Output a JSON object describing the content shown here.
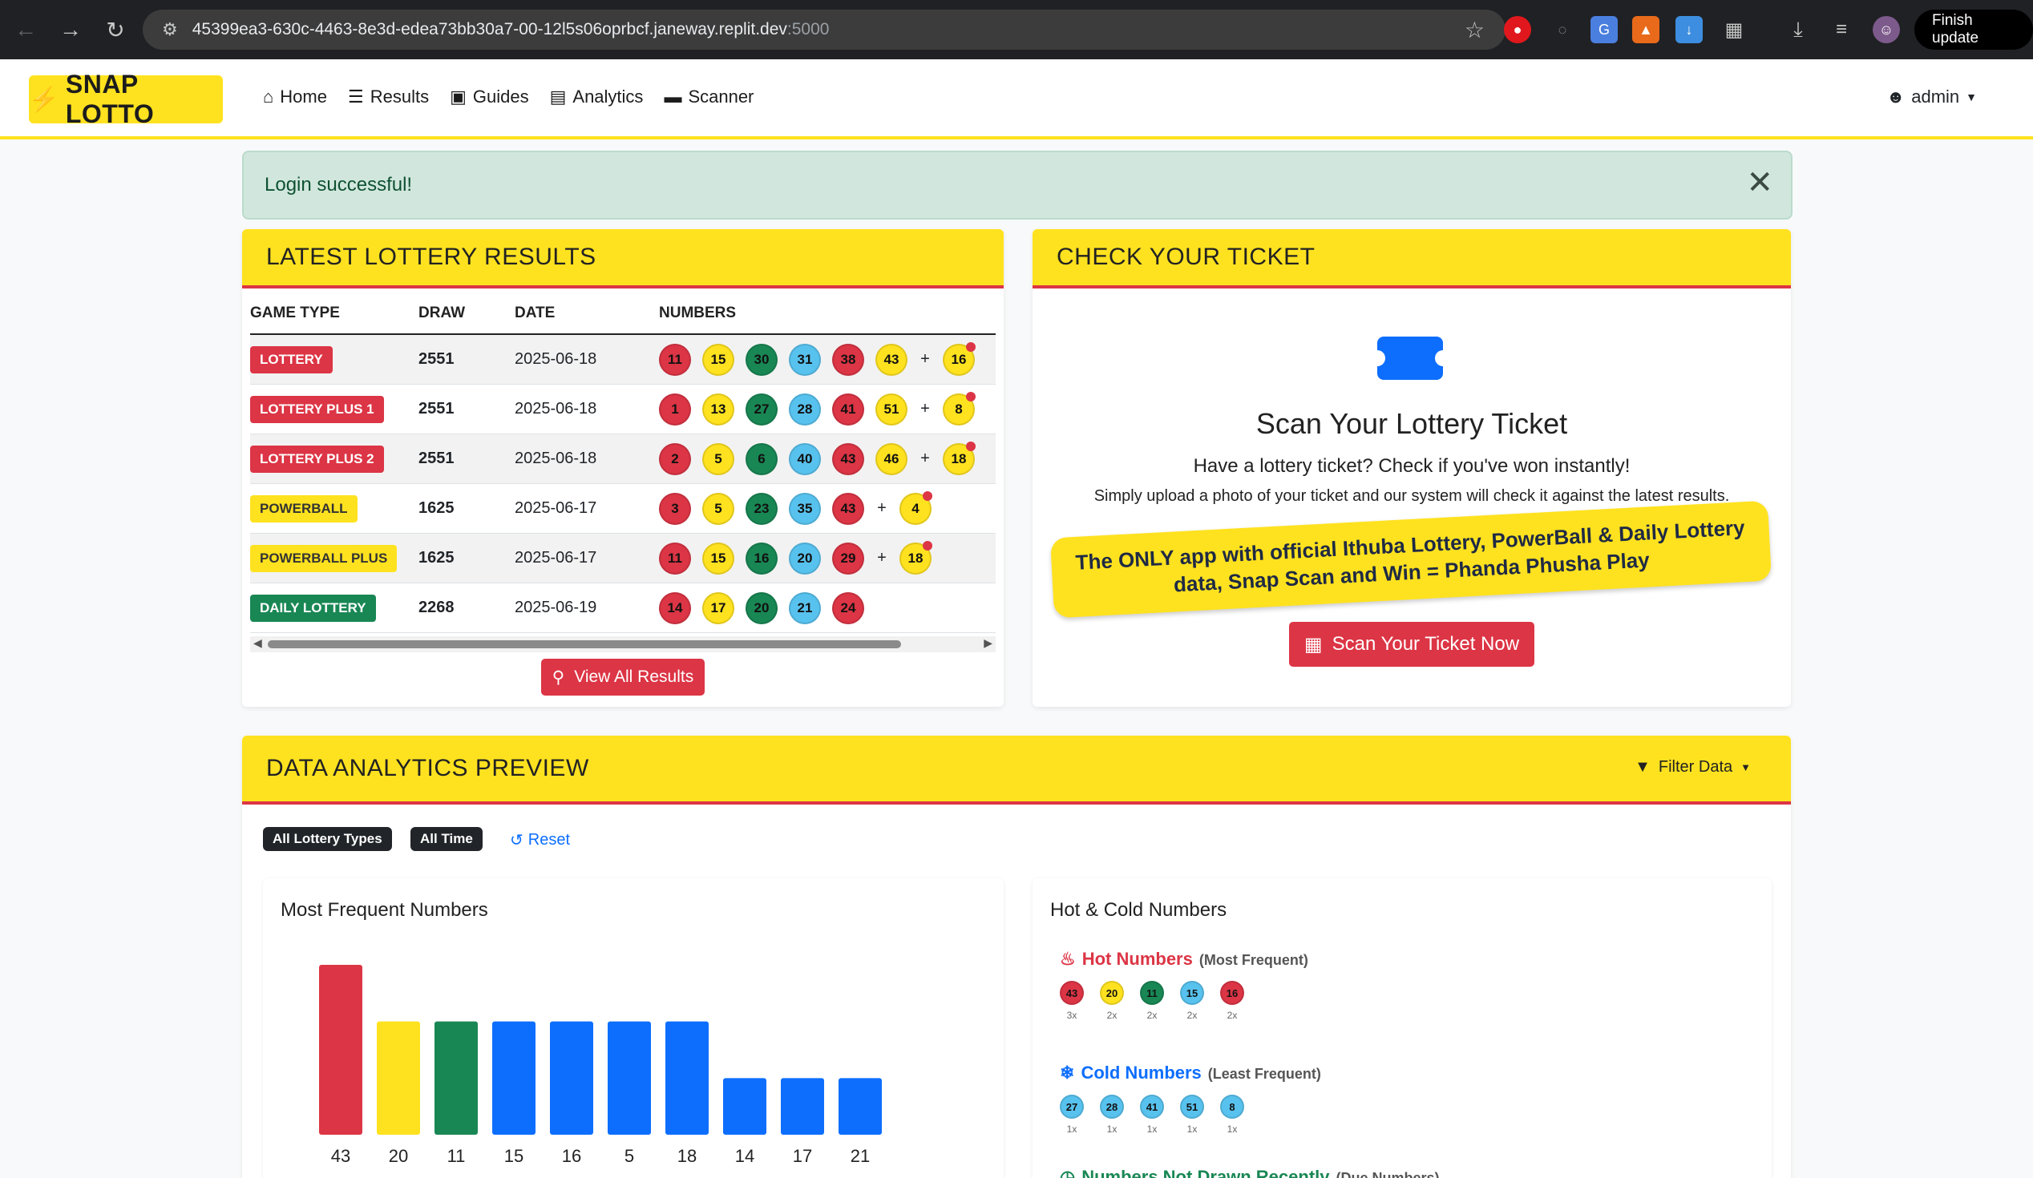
{
  "browser": {
    "url": "45399ea3-630c-4463-8e3d-edea73bb30a7-00-12l5s06oprbcf.janeway.replit.dev",
    "port": ":5000",
    "finish_update": "Finish update"
  },
  "navbar": {
    "brand": "SNAP LOTTO",
    "links": [
      "Home",
      "Results",
      "Guides",
      "Analytics",
      "Scanner"
    ],
    "user": "admin"
  },
  "alert": {
    "message": "Login successful!"
  },
  "results": {
    "title": "LATEST LOTTERY RESULTS",
    "headers": [
      "GAME TYPE",
      "DRAW",
      "DATE",
      "NUMBERS"
    ],
    "rows": [
      {
        "game": "LOTTERY",
        "draw": "2551",
        "date": "2025-06-18",
        "numbers": [
          "11",
          "15",
          "30",
          "31",
          "38",
          "43"
        ],
        "bonus": "16"
      },
      {
        "game": "LOTTERY PLUS 1",
        "draw": "2551",
        "date": "2025-06-18",
        "numbers": [
          "1",
          "13",
          "27",
          "28",
          "41",
          "51"
        ],
        "bonus": "8"
      },
      {
        "game": "LOTTERY PLUS 2",
        "draw": "2551",
        "date": "2025-06-18",
        "numbers": [
          "2",
          "5",
          "6",
          "40",
          "43",
          "46"
        ],
        "bonus": "18"
      },
      {
        "game": "POWERBALL",
        "draw": "1625",
        "date": "2025-06-17",
        "numbers": [
          "3",
          "5",
          "23",
          "35",
          "43"
        ],
        "bonus": "4"
      },
      {
        "game": "POWERBALL PLUS",
        "draw": "1625",
        "date": "2025-06-17",
        "numbers": [
          "11",
          "15",
          "16",
          "20",
          "29"
        ],
        "bonus": "18"
      },
      {
        "game": "DAILY LOTTERY",
        "draw": "2268",
        "date": "2025-06-19",
        "numbers": [
          "14",
          "17",
          "20",
          "21",
          "24"
        ],
        "bonus": ""
      }
    ],
    "view_all": "View All Results"
  },
  "check": {
    "title": "CHECK YOUR TICKET",
    "heading": "Scan Your Lottery Ticket",
    "sub1": "Have a lottery ticket? Check if you've won instantly!",
    "sub2": "Simply upload a photo of your ticket and our system will check it against the latest results.",
    "banner": "The ONLY app with official Ithuba Lottery, PowerBall & Daily Lottery data, Snap Scan and Win = Phanda Phusha Play",
    "button": "Scan Your Ticket Now"
  },
  "analytics": {
    "title": "DATA ANALYTICS PREVIEW",
    "filter": "Filter Data",
    "chips": [
      "All Lottery Types",
      "All Time"
    ],
    "reset": "Reset",
    "frequent_title": "Most Frequent Numbers",
    "hotcold_title": "Hot & Cold Numbers",
    "hot_label": "Hot Numbers",
    "hot_sub": "(Most Frequent)",
    "hot": [
      {
        "n": "43",
        "c": "3x"
      },
      {
        "n": "20",
        "c": "2x"
      },
      {
        "n": "11",
        "c": "2x"
      },
      {
        "n": "15",
        "c": "2x"
      },
      {
        "n": "16",
        "c": "2x"
      }
    ],
    "cold_label": "Cold Numbers",
    "cold_sub": "(Least Frequent)",
    "cold": [
      {
        "n": "27",
        "c": "1x"
      },
      {
        "n": "28",
        "c": "1x"
      },
      {
        "n": "41",
        "c": "1x"
      },
      {
        "n": "51",
        "c": "1x"
      },
      {
        "n": "8",
        "c": "1x"
      }
    ],
    "due_label": "Numbers Not Drawn Recently",
    "due_sub": "(Due Numbers)"
  },
  "colors": {
    "red": "#dc3545",
    "yellow": "#ffe21f",
    "green": "#198754",
    "blue": "#0d6efd",
    "lightblue": "#58c2ee"
  },
  "chart_data": {
    "type": "bar",
    "title": "Most Frequent Numbers",
    "categories": [
      "43",
      "20",
      "11",
      "15",
      "16",
      "5",
      "18",
      "14",
      "17",
      "21"
    ],
    "values": [
      3,
      2,
      2,
      2,
      2,
      2,
      2,
      1,
      1,
      1
    ],
    "bar_colors": [
      "#dc3545",
      "#ffe21f",
      "#198754",
      "#0d6efd",
      "#0d6efd",
      "#0d6efd",
      "#0d6efd",
      "#0d6efd",
      "#0d6efd",
      "#0d6efd"
    ],
    "xlabel": "",
    "ylabel": "",
    "ylim": [
      0,
      3
    ]
  }
}
